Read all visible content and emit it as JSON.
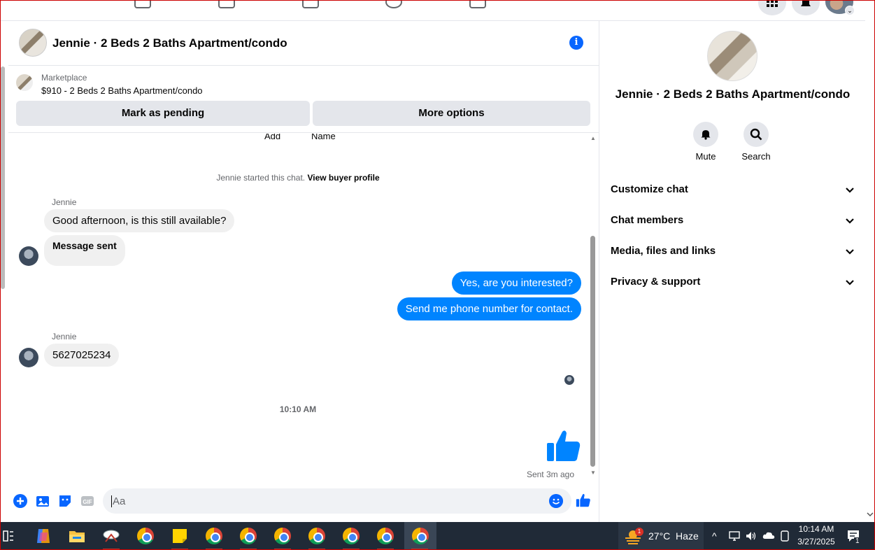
{
  "chat": {
    "title": "Jennie · 2 Beds 2 Baths Apartment/condo",
    "marketplace_label": "Marketplace",
    "listing": "$910 - 2 Beds 2 Baths Apartment/condo",
    "mark_pending": "Mark as pending",
    "more_options": "More options",
    "cut_labels": [
      "Add",
      "Name"
    ],
    "started_prefix": "Jennie started this chat.",
    "view_profile": "View buyer profile",
    "messages": [
      {
        "sender": "Jennie",
        "text": "Good afternoon, is this still available?"
      },
      {
        "text": "Message sent"
      },
      {
        "text": "Yes, are you interested?"
      },
      {
        "text": "Send me phone number for contact."
      },
      {
        "sender": "Jennie",
        "text": "5627025234"
      }
    ],
    "timestamp": "10:10 AM",
    "sent_status": "Sent 3m ago",
    "composer_placeholder": "Aa"
  },
  "details": {
    "title": "Jennie · 2 Beds 2 Baths Apartment/condo",
    "mute": "Mute",
    "search": "Search",
    "sections": [
      "Customize chat",
      "Chat members",
      "Media, files and links",
      "Privacy & support"
    ]
  },
  "taskbar": {
    "weather": "27°C  Haze",
    "weather_badge": "1",
    "time": "10:14 AM",
    "date": "3/27/2025",
    "notif_count": "1"
  },
  "colors": {
    "brand": "#0866ff",
    "bubble_out": "#0084ff",
    "bubble_in": "#f0f0f0",
    "taskbar": "#202a37"
  }
}
